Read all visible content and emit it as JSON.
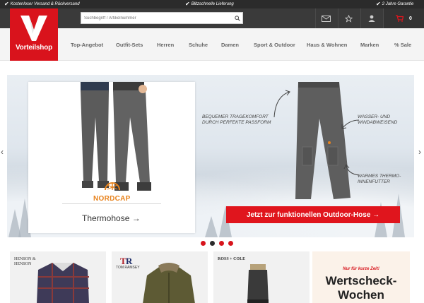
{
  "topbar": {
    "usp1": "Kostenloser Versand & Rückversand",
    "usp2": "Blitzschnelle Lieferung",
    "usp3": "2 Jahre Garantie"
  },
  "logo": {
    "text": "Vorteilshop"
  },
  "search": {
    "placeholder": "Suchbegriff / Artikelnummer"
  },
  "cart": {
    "count": "0"
  },
  "nav": {
    "items": [
      "Top-Angebot",
      "Outfit-Sets",
      "Herren",
      "Schuhe",
      "Damen",
      "Sport & Outdoor",
      "Haus & Wohnen",
      "Marken",
      "% Sale"
    ]
  },
  "hero": {
    "brand": "NORDCAP",
    "product": "Thermohose →",
    "annot1": "Bequemer Tragekomfort durch perfekte Passform",
    "annot2": "Wasser- und windabweisend",
    "annot3": "Warmes Thermo-innenfutter",
    "cta": "Jetzt zur funktionellen Outdoor-Hose →",
    "slides": 4,
    "active_slide": 2
  },
  "teasers": {
    "t1": "HENSON & HENSON",
    "t2": "TOM RAMSEY",
    "t3": "ROSS + COLE",
    "wert_sub": "Nur für kurze Zeit!",
    "wert_t1": "Wertscheck-",
    "wert_t2": "Wochen"
  },
  "colors": {
    "brand_red": "#d9131c",
    "dark": "#2b2b2b"
  }
}
